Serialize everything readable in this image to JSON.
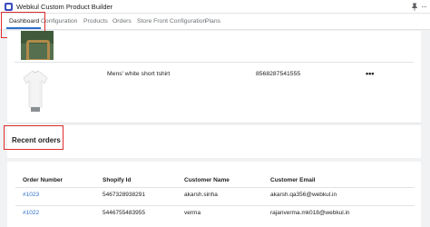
{
  "app": {
    "title": "Webkul Custom Product Builder",
    "pin_icon": "pin-icon",
    "more_icon": "more-horizontal-icon"
  },
  "nav": {
    "tabs": [
      {
        "label": "Dashboard",
        "active": true
      },
      {
        "label": "Configuration",
        "active": false
      },
      {
        "label": "Products",
        "active": false
      },
      {
        "label": "Orders",
        "active": false
      },
      {
        "label": "Store Front Configuration",
        "active": false
      },
      {
        "label": "Plans",
        "active": false
      }
    ]
  },
  "products": {
    "rows": [
      {
        "name": "Mens' white short tshirt",
        "id": "8568287541555",
        "actions_label": "•••"
      }
    ]
  },
  "recent_orders": {
    "title": "Recent orders",
    "columns": [
      "Order Number",
      "Shopify Id",
      "Customer Name",
      "Customer Email"
    ],
    "rows": [
      {
        "order_number": "#1023",
        "shopify_id": "5467328938291",
        "customer_name": "akarsh.sinha",
        "customer_email": "akarsh.qa356@webkul.in"
      },
      {
        "order_number": "#1022",
        "shopify_id": "5446755483955",
        "customer_name": "verma",
        "customer_email": "rajanverma.mk018@webkul.in"
      }
    ]
  },
  "colors": {
    "accent": "#2c6ecb",
    "highlight": "#e02d2d",
    "background": "#f1f2f4"
  }
}
